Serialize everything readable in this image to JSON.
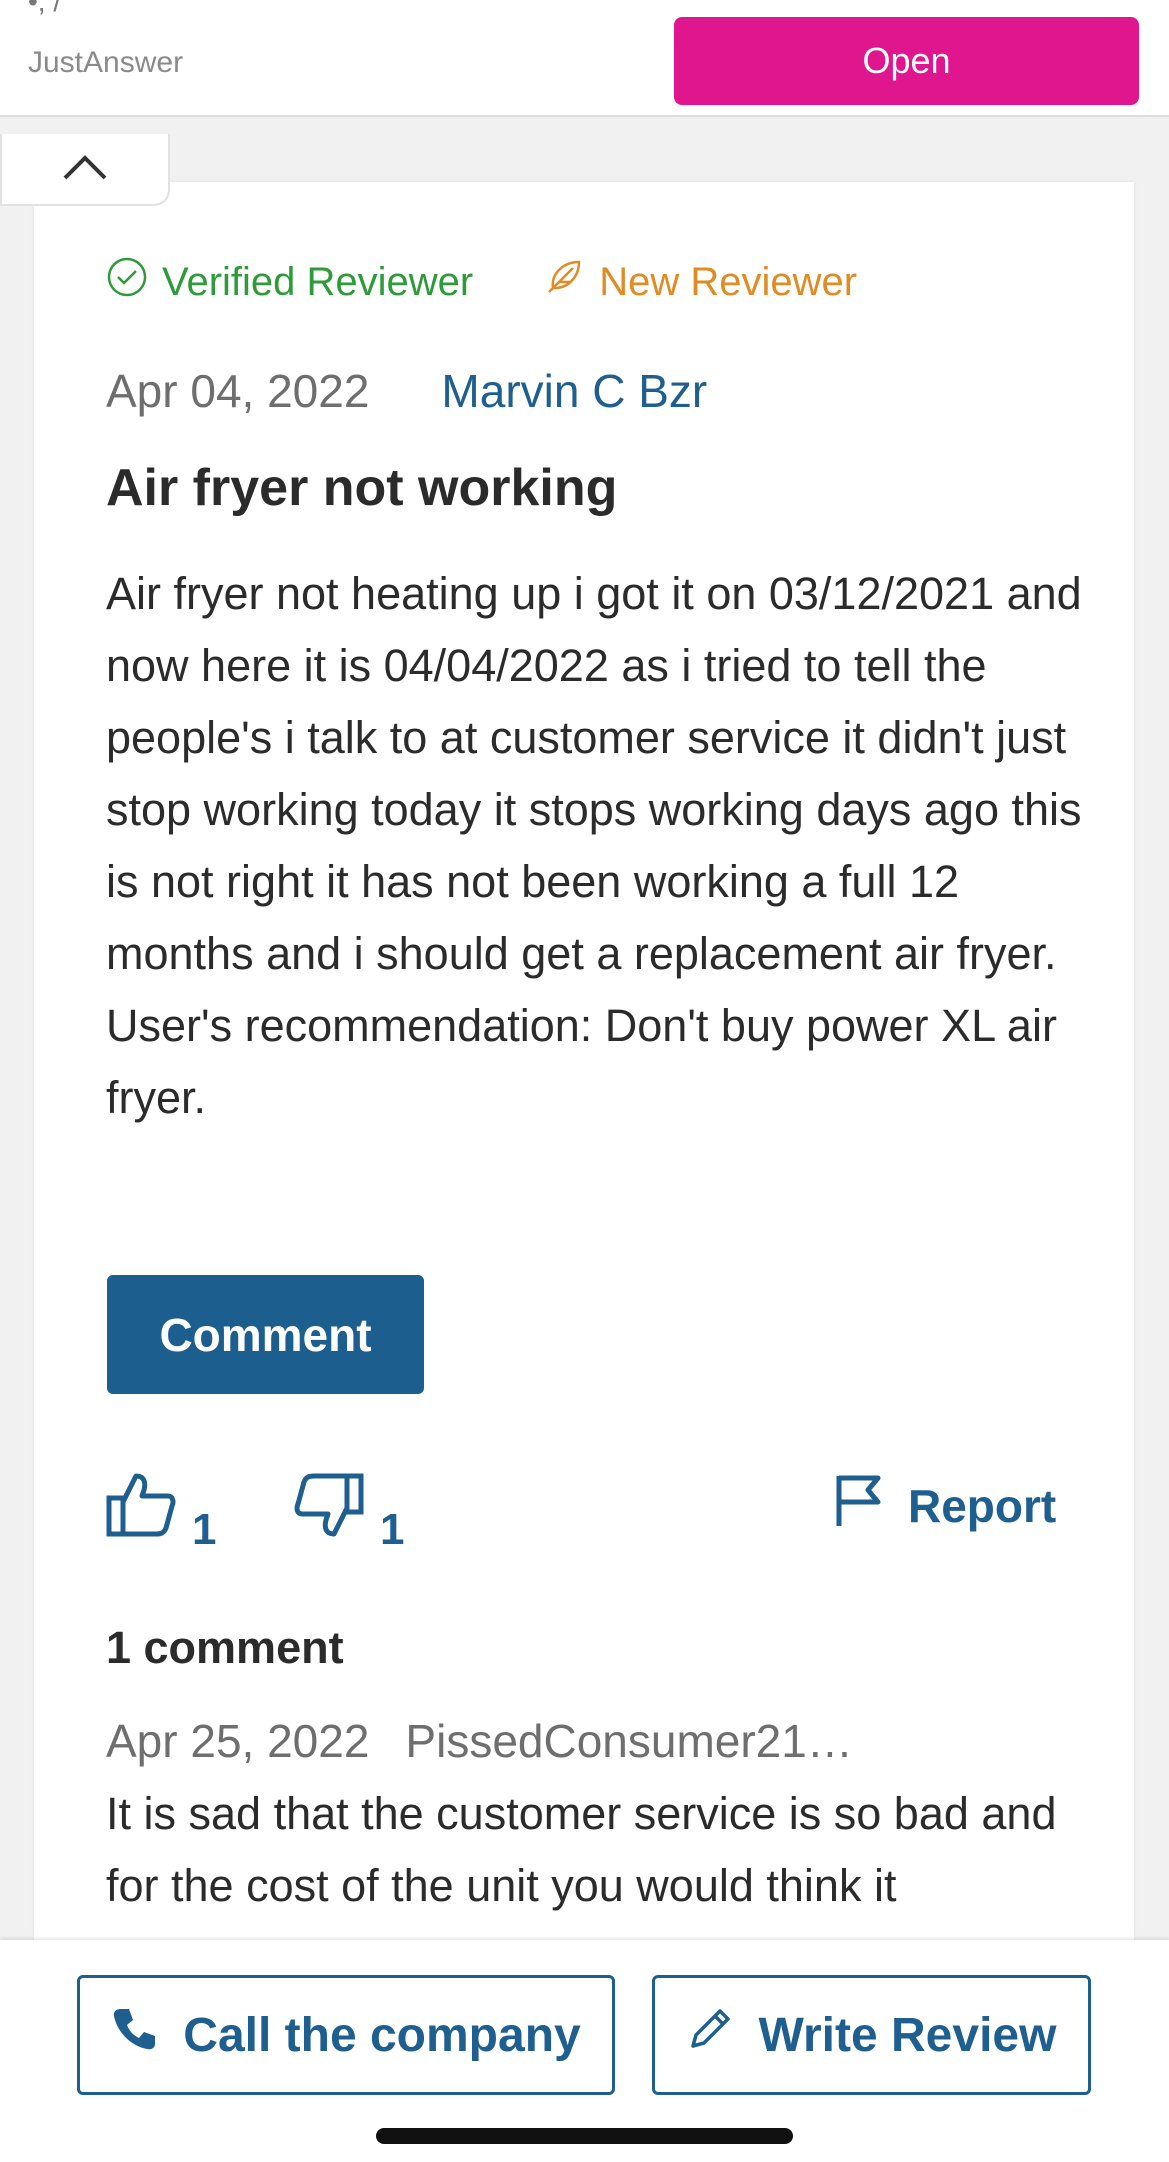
{
  "ad": {
    "top_cut_text": "•, /",
    "brand": "JustAnswer",
    "open_label": "Open"
  },
  "review": {
    "badges": {
      "verified": "Verified Reviewer",
      "new": "New Reviewer"
    },
    "date": "Apr 04, 2022",
    "author": "Marvin C Bzr",
    "title": "Air fryer not working",
    "body": "Air fryer not heating up i got it on 03/12/2021 and now here it is 04/04/2022 as i tried to tell the people's i talk to at customer service it didn't just stop working today it stops working days ago this is not right it has not been working a full 12 months and i should get a replacement air fryer.\nUser's recommendation: Don't buy power XL air fryer.",
    "comment_button": "Comment",
    "thumbs_up_count": "1",
    "thumbs_down_count": "1",
    "report_label": "Report",
    "comments_count": "1 comment",
    "comment": {
      "date": "Apr 25, 2022",
      "author": "PissedConsumer21…",
      "text": "It is sad that the customer service is so bad and for the cost of the unit you would think it"
    }
  },
  "bottom_bar": {
    "call_label": "Call the company",
    "write_label": "Write Review"
  },
  "colors": {
    "accent_pink": "#e0168f",
    "brand_blue": "#1c5e8e",
    "verified_green": "#2f9a39",
    "new_orange": "#e08b24"
  },
  "icons": [
    "chevron-up-icon",
    "check-circle-icon",
    "feather-icon",
    "thumbs-up-icon",
    "thumbs-down-icon",
    "flag-icon",
    "phone-icon",
    "pencil-icon"
  ]
}
